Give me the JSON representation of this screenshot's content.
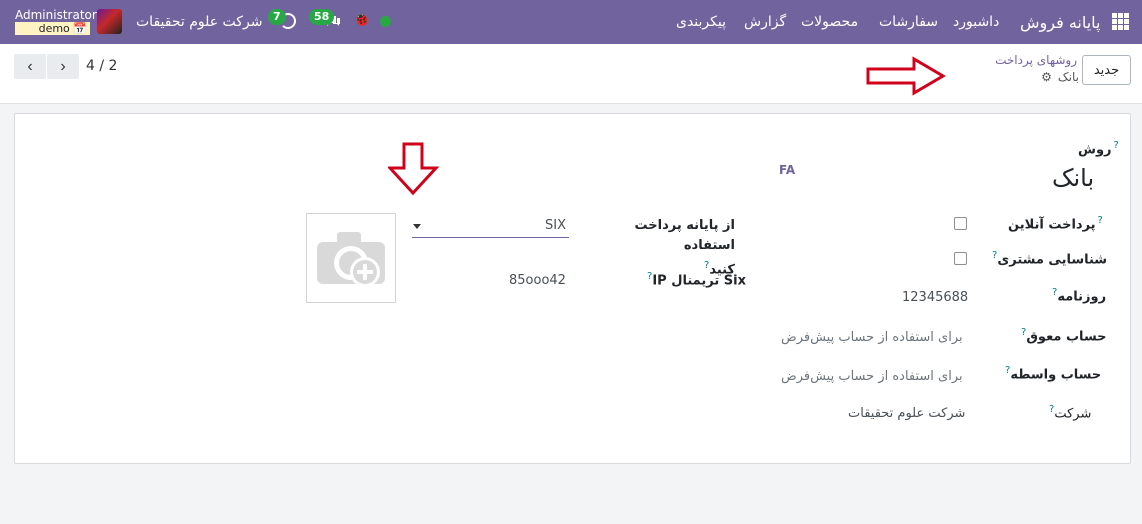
{
  "navbar": {
    "brand": "پایانه فروش",
    "menu": [
      "داشبورد",
      "سفارشات",
      "محصولات",
      "گزارش",
      "پیکربندی"
    ],
    "chat_count": "58",
    "activity_count": "7",
    "company": "شرکت علوم تحقیقات",
    "user": "Administrator",
    "database": "demo"
  },
  "control_panel": {
    "new_label": "جدید",
    "breadcrumb_parent": "روشهای پرداخت",
    "breadcrumb_current": "بانک",
    "pager_value": "4 / 2"
  },
  "form": {
    "method_label": "روش",
    "method_name": "بانک",
    "lang_code": "FA",
    "online_payment_label": "پرداخت آنلاین",
    "online_payment_checked": false,
    "identify_customer_label": "شناسایی مشتری",
    "identify_customer_checked": false,
    "journal_label": "روزنامه",
    "journal_value": "12345688",
    "outstanding_account_label": "حساب معوق",
    "outstanding_account_placeholder": "برای استفاده از حساب پیش‌فرض",
    "intermediary_account_label": "حساب واسطه",
    "intermediary_account_placeholder": "برای استفاده از حساب پیش‌فرض",
    "company_label": "شرکت",
    "company_value": "شرکت علوم تحقیقات",
    "terminal_use_label_line1": "از پایانه پرداخت استفاده",
    "terminal_use_label_line2": "کنید",
    "terminal_value": "SIX",
    "six_ip_label": "IP تریمنال Six",
    "six_ip_value": "85ooo42",
    "help_mark": "?"
  },
  "colors": {
    "navbar_bg": "#71639e",
    "badge_green": "#28a745",
    "annotation_red": "#d0021b"
  }
}
